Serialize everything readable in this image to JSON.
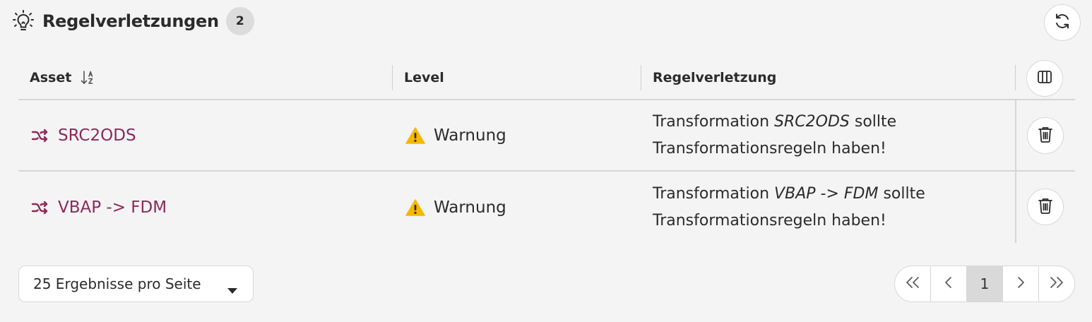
{
  "header": {
    "title": "Regelverletzungen",
    "count": "2",
    "icon": "lightbulb-icon"
  },
  "table": {
    "columns": [
      {
        "label": "Asset"
      },
      {
        "label": "Level"
      },
      {
        "label": "Regelverletzung"
      }
    ],
    "rows": [
      {
        "asset": "SRC2ODS",
        "level": "Warnung",
        "violation_prefix": "Transformation ",
        "violation_name": "SRC2ODS",
        "violation_suffix": " sollte",
        "violation_line2": "Transformationsregeln haben!"
      },
      {
        "asset": "VBAP -> FDM",
        "level": "Warnung",
        "violation_prefix": "Transformation ",
        "violation_name": "VBAP -> FDM",
        "violation_suffix": " sollte",
        "violation_line2": "Transformationsregeln haben!"
      }
    ]
  },
  "footer": {
    "per_page": "25 Ergebnisse pro Seite",
    "pagination": {
      "first": "«",
      "prev": "‹",
      "current": "1",
      "next": "›",
      "last": "»"
    }
  },
  "colors": {
    "accent": "#8b2a5b",
    "warning": "#f5b800",
    "background": "#f4f4f4"
  }
}
